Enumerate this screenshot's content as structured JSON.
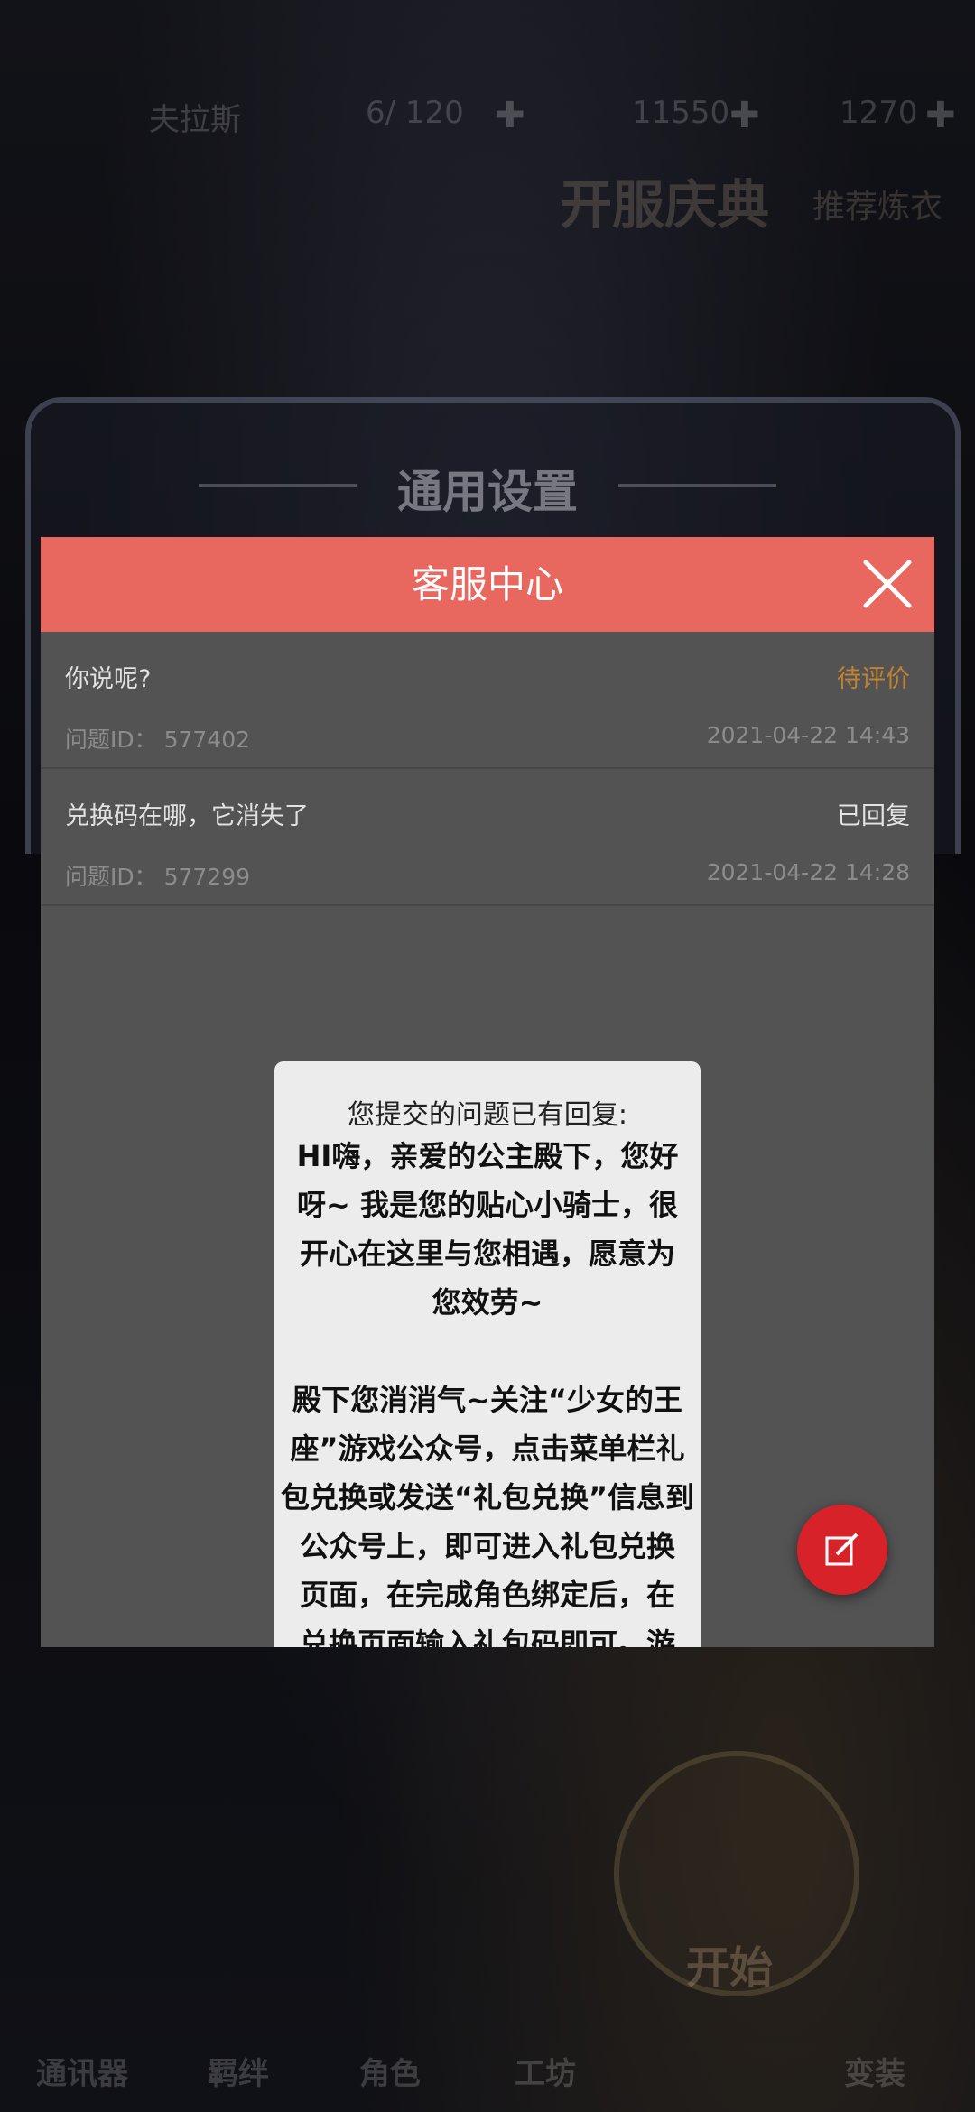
{
  "background_hud": {
    "player_name": "夫拉斯",
    "energy": "6/ 120",
    "gold": "11550",
    "gems": "1270",
    "banner_title": "开服庆典",
    "banner_subtitle": "推荐炼衣",
    "settings_title": "通用设置",
    "nav": [
      "通讯器",
      "羁绊",
      "角色",
      "工坊",
      "",
      "变装"
    ],
    "start_label": "开始"
  },
  "cs": {
    "title": "客服中心",
    "tickets": [
      {
        "question": "你说呢?",
        "status": "待评价",
        "id_label": "问题ID： 577402",
        "time": "2021-04-22 14:43"
      },
      {
        "question": "兑换码在哪，它消失了",
        "status": "已回复",
        "id_label": "问题ID： 577299",
        "time": "2021-04-22 14:28"
      }
    ],
    "icons": {
      "close": "close-icon",
      "compose": "edit-icon"
    },
    "colors": {
      "header": "#e8685f",
      "pending_status": "#c3822d",
      "fab": "#d8222a"
    }
  },
  "reply": {
    "intro": "您提交的问题已有回复:",
    "para1_lines": [
      "HI嗨，亲爱的公主殿下，您好",
      "呀~ 我是您的贴心小骑士，很",
      "开心在这里与您相遇，愿意为",
      "您效劳~"
    ],
    "para2_lines": [
      "殿下您消消气~关注“少女的王",
      "座”游戏公众号，点击菜单栏礼",
      "包兑换或发送“礼包兑换”信息到",
      "公众号上，即可进入礼包兑换",
      "页面，在完成角色绑定后，在",
      "兑换页面输入礼包码即可。游"
    ]
  }
}
